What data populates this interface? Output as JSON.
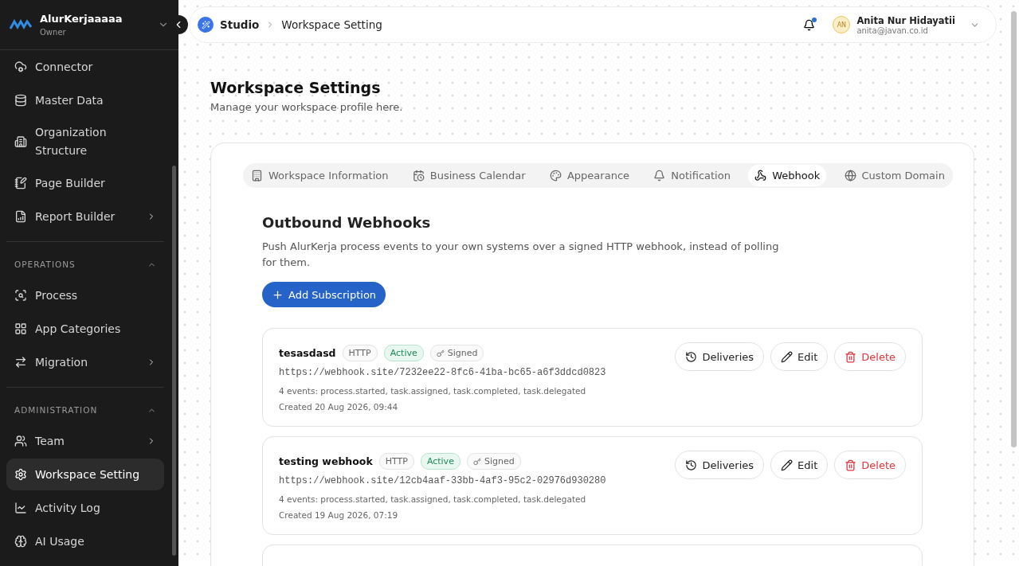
{
  "workspace": {
    "name": "AlurKerjaaaaa",
    "role": "Owner"
  },
  "sidebar": {
    "items": [
      {
        "label": "Connector",
        "submenu": false,
        "selected": false
      },
      {
        "label": "Master Data",
        "submenu": false,
        "selected": false
      },
      {
        "label": "Organization Structure",
        "submenu": false,
        "selected": false
      },
      {
        "label": "Page Builder",
        "submenu": false,
        "selected": false
      },
      {
        "label": "Report Builder",
        "submenu": true,
        "selected": false
      }
    ],
    "sections": [
      {
        "title": "OPERATIONS",
        "expanded": true,
        "items": [
          {
            "label": "Process",
            "submenu": false,
            "selected": false
          },
          {
            "label": "App Categories",
            "submenu": false,
            "selected": false
          },
          {
            "label": "Migration",
            "submenu": true,
            "selected": false
          }
        ]
      },
      {
        "title": "ADMINISTRATION",
        "expanded": true,
        "items": [
          {
            "label": "Team",
            "submenu": true,
            "selected": false
          },
          {
            "label": "Workspace Setting",
            "submenu": false,
            "selected": true
          },
          {
            "label": "Activity Log",
            "submenu": false,
            "selected": false
          },
          {
            "label": "AI Usage",
            "submenu": false,
            "selected": false
          }
        ]
      }
    ]
  },
  "breadcrumb": [
    "Studio",
    "Workspace Setting"
  ],
  "notifications": {
    "unread": true
  },
  "user": {
    "initials": "AN",
    "name": "Anita Nur Hidayatii",
    "email": "anita@javan.co.id"
  },
  "page": {
    "title": "Workspace Settings",
    "subtitle": "Manage your workspace profile here."
  },
  "tabs": [
    {
      "label": "Workspace Information",
      "selected": false
    },
    {
      "label": "Business Calendar",
      "selected": false
    },
    {
      "label": "Appearance",
      "selected": false
    },
    {
      "label": "Notification",
      "selected": false
    },
    {
      "label": "Webhook",
      "selected": true
    },
    {
      "label": "Custom Domain",
      "selected": false
    }
  ],
  "webhooks": {
    "title": "Outbound Webhooks",
    "description": "Push AlurKerja process events to your own systems over a signed HTTP webhook, instead of polling for them.",
    "add_button": "Add Subscription",
    "items": [
      {
        "name": "tesasdasd",
        "protocol": "HTTP",
        "status": "Active",
        "signed": "Signed",
        "url": "https://webhook.site/7232ee22-8fc6-41ba-bc65-a6f3ddcd0823",
        "events": "4 events: process.started, task.assigned, task.completed, task.delegated",
        "created": "Created 20 Aug 2026, 09:44",
        "actions": [
          "Deliveries",
          "Edit",
          "Delete"
        ]
      },
      {
        "name": "testing webhook",
        "protocol": "HTTP",
        "status": "Active",
        "signed": "Signed",
        "url": "https://webhook.site/12cb4aaf-33bb-4af3-95c2-02976d930280",
        "events": "4 events: process.started, task.assigned, task.completed, task.delegated",
        "created": "Created 19 Aug 2026, 07:19",
        "actions": [
          "Deliveries",
          "Edit",
          "Delete"
        ]
      }
    ]
  }
}
